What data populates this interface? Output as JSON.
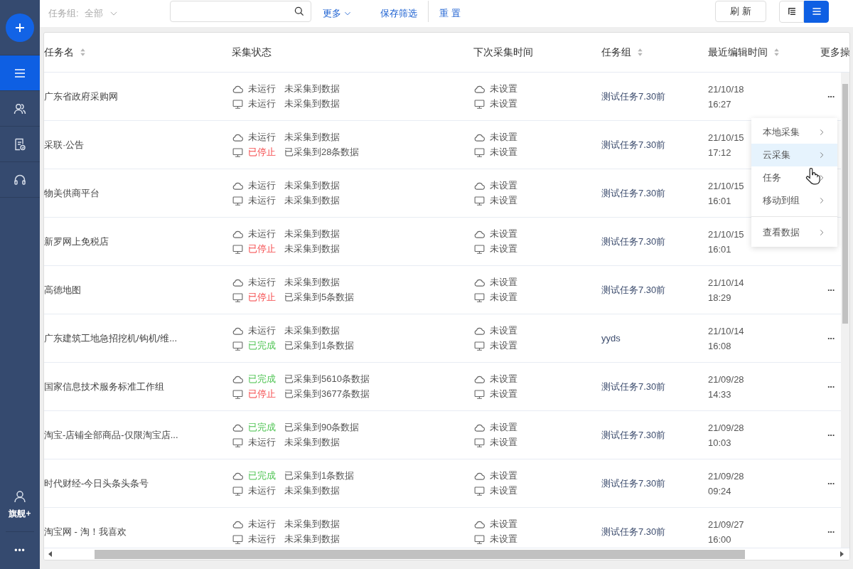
{
  "sidebar": {
    "items": [
      {
        "kind": "list",
        "selected": true
      },
      {
        "kind": "users",
        "selected": false
      },
      {
        "kind": "document",
        "selected": false
      },
      {
        "kind": "headset",
        "selected": false
      }
    ],
    "plan_label": "旗舰+",
    "more": "•••"
  },
  "toolbar": {
    "filter": {
      "label": "任务组:",
      "value": "全部"
    },
    "links": [
      {
        "label": "更多",
        "kind": "dropdown"
      },
      {
        "label": "保存筛选",
        "kind": "link"
      },
      {
        "label": "重 置",
        "kind": "reset"
      }
    ],
    "refresh": "刷 新",
    "view_toggle": [
      {
        "kind": "tree",
        "selected": false
      },
      {
        "kind": "list",
        "selected": true
      }
    ]
  },
  "table": {
    "columns": [
      {
        "label": "任务名",
        "kind": "sortable"
      },
      {
        "label": "采集状态",
        "kind": "plain"
      },
      {
        "label": "下次采集时间",
        "kind": "plain"
      },
      {
        "label": "任务组",
        "kind": "sortable"
      },
      {
        "label": "最近编辑时间",
        "kind": "sortable"
      },
      {
        "label": "更多操",
        "kind": "plain"
      }
    ],
    "rows": [
      {
        "name": "广东省政府采购网",
        "cloud": {
          "kind": "idle",
          "status_text": "未运行",
          "detail": "未采集到数据"
        },
        "local": {
          "kind": "idle",
          "status_text": "未运行",
          "detail": "未采集到数据"
        },
        "next_cloud": "未设置",
        "next_local": "未设置",
        "group": "测试任务7.30前",
        "edited_date": "21/10/18",
        "edited_time": "16:27",
        "more": "···"
      },
      {
        "name": "采联·公告",
        "cloud": {
          "kind": "idle",
          "status_text": "未运行",
          "detail": "未采集到数据"
        },
        "local": {
          "kind": "stopped",
          "status_text": "已停止",
          "detail": "已采集到28条数据"
        },
        "next_cloud": "未设置",
        "next_local": "未设置",
        "group": "测试任务7.30前",
        "edited_date": "21/10/15",
        "edited_time": "17:12"
      },
      {
        "name": "物美供商平台",
        "cloud": {
          "kind": "idle",
          "status_text": "未运行",
          "detail": "未采集到数据"
        },
        "local": {
          "kind": "idle",
          "status_text": "未运行",
          "detail": "未采集到数据"
        },
        "next_cloud": "未设置",
        "next_local": "未设置",
        "group": "测试任务7.30前",
        "edited_date": "21/10/15",
        "edited_time": "16:01"
      },
      {
        "name": "新罗网上免税店",
        "cloud": {
          "kind": "idle",
          "status_text": "未运行",
          "detail": "未采集到数据"
        },
        "local": {
          "kind": "stopped",
          "status_text": "已停止",
          "detail": "未采集到数据"
        },
        "next_cloud": "未设置",
        "next_local": "未设置",
        "group": "测试任务7.30前",
        "edited_date": "21/10/15",
        "edited_time": "16:01"
      },
      {
        "name": "高德地图",
        "cloud": {
          "kind": "idle",
          "status_text": "未运行",
          "detail": "未采集到数据"
        },
        "local": {
          "kind": "stopped",
          "status_text": "已停止",
          "detail": "已采集到5条数据"
        },
        "next_cloud": "未设置",
        "next_local": "未设置",
        "group": "测试任务7.30前",
        "edited_date": "21/10/14",
        "edited_time": "18:29",
        "more": "···"
      },
      {
        "name": "广东建筑工地急招挖机/钩机/维...",
        "cloud": {
          "kind": "idle",
          "status_text": "未运行",
          "detail": "未采集到数据"
        },
        "local": {
          "kind": "done",
          "status_text": "已完成",
          "detail": "已采集到1条数据"
        },
        "next_cloud": "未设置",
        "next_local": "未设置",
        "group": "yyds",
        "edited_date": "21/10/14",
        "edited_time": "16:08",
        "more": "···"
      },
      {
        "name": "国家信息技术服务标准工作组",
        "cloud": {
          "kind": "done",
          "status_text": "已完成",
          "detail": "已采集到5610条数据"
        },
        "local": {
          "kind": "stopped",
          "status_text": "已停止",
          "detail": "已采集到3677条数据"
        },
        "next_cloud": "未设置",
        "next_local": "未设置",
        "group": "测试任务7.30前",
        "edited_date": "21/09/28",
        "edited_time": "14:33",
        "more": "···"
      },
      {
        "name": "淘宝-店铺全部商品-仅限淘宝店...",
        "cloud": {
          "kind": "done",
          "status_text": "已完成",
          "detail": "已采集到90条数据"
        },
        "local": {
          "kind": "idle",
          "status_text": "未运行",
          "detail": "未采集到数据"
        },
        "next_cloud": "未设置",
        "next_local": "未设置",
        "group": "测试任务7.30前",
        "edited_date": "21/09/28",
        "edited_time": "10:03",
        "more": "···"
      },
      {
        "name": "时代财经-今日头条头条号",
        "cloud": {
          "kind": "done",
          "status_text": "已完成",
          "detail": "已采集到1条数据"
        },
        "local": {
          "kind": "idle",
          "status_text": "未运行",
          "detail": "未采集到数据"
        },
        "next_cloud": "未设置",
        "next_local": "未设置",
        "group": "测试任务7.30前",
        "edited_date": "21/09/28",
        "edited_time": "09:24",
        "more": "···"
      },
      {
        "name": "淘宝网 - 淘！我喜欢",
        "cloud": {
          "kind": "idle",
          "status_text": "未运行",
          "detail": "未采集到数据"
        },
        "local": {
          "kind": "idle",
          "status_text": "未运行",
          "detail": "未采集到数据"
        },
        "next_cloud": "未设置",
        "next_local": "未设置",
        "group": "测试任务7.30前",
        "edited_date": "21/09/27",
        "edited_time": "16:00",
        "more": "···"
      }
    ]
  },
  "context_menu": {
    "groups": [
      {
        "items": [
          {
            "label": "本地采集",
            "selected": false
          },
          {
            "label": "云采集",
            "selected": true
          },
          {
            "label": "任务",
            "selected": false
          },
          {
            "label": "移动到组",
            "selected": false
          }
        ]
      },
      {
        "items": [
          {
            "label": "查看数据",
            "selected": false
          }
        ]
      }
    ]
  }
}
